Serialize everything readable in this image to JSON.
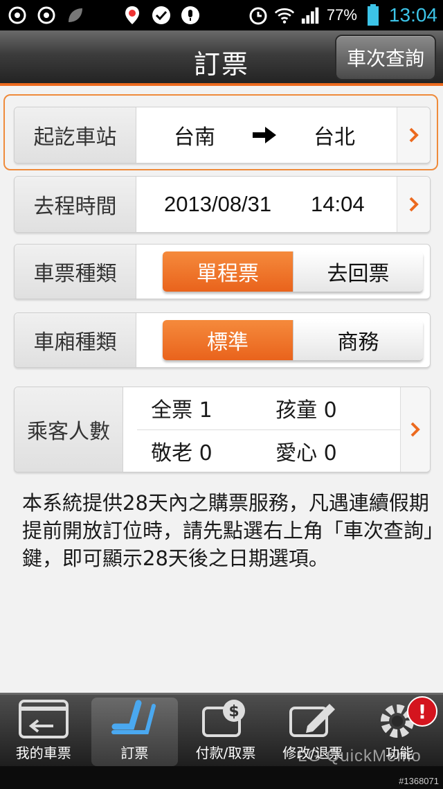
{
  "status_bar": {
    "battery_percent": "77%",
    "time": "13:04",
    "icons": [
      "app-icon",
      "app-icon",
      "leaf-icon",
      "location-pin-icon",
      "check-bubble-icon",
      "mic-icon",
      "alarm-icon",
      "wifi-icon",
      "signal-icon",
      "battery-icon"
    ]
  },
  "header": {
    "title": "訂票",
    "search_button": "車次查詢"
  },
  "rows": {
    "stations": {
      "label": "起訖車站",
      "from": "台南",
      "to": "台北"
    },
    "departure": {
      "label": "去程時間",
      "date": "2013/08/31",
      "time": "14:04"
    },
    "ticket_type": {
      "label": "車票種類",
      "options": [
        "單程票",
        "去回票"
      ],
      "selected": "單程票"
    },
    "car_type": {
      "label": "車廂種類",
      "options": [
        "標準",
        "商務"
      ],
      "selected": "標準"
    },
    "passengers": {
      "label": "乘客人數",
      "adult": "全票 1",
      "child": "孩童 0",
      "senior": "敬老 0",
      "disabled": "愛心 0"
    }
  },
  "note": "本系統提供28天內之購票服務，凡遇連續假期提前開放訂位時，請先點選右上角「車次查詢」鍵，即可顯示28天後之日期選項。",
  "bottom_nav": {
    "items": [
      "我的車票",
      "訂票",
      "付款/取票",
      "修改/退票",
      "功能"
    ],
    "active": "訂票",
    "badge": "!"
  },
  "watermark": "LG QuickMemo",
  "image_id": "#1368071",
  "colors": {
    "accent": "#ec6a1f",
    "header_dark": "#2e2e2e",
    "time_blue": "#3cc4e8",
    "badge_red": "#d4141e"
  }
}
